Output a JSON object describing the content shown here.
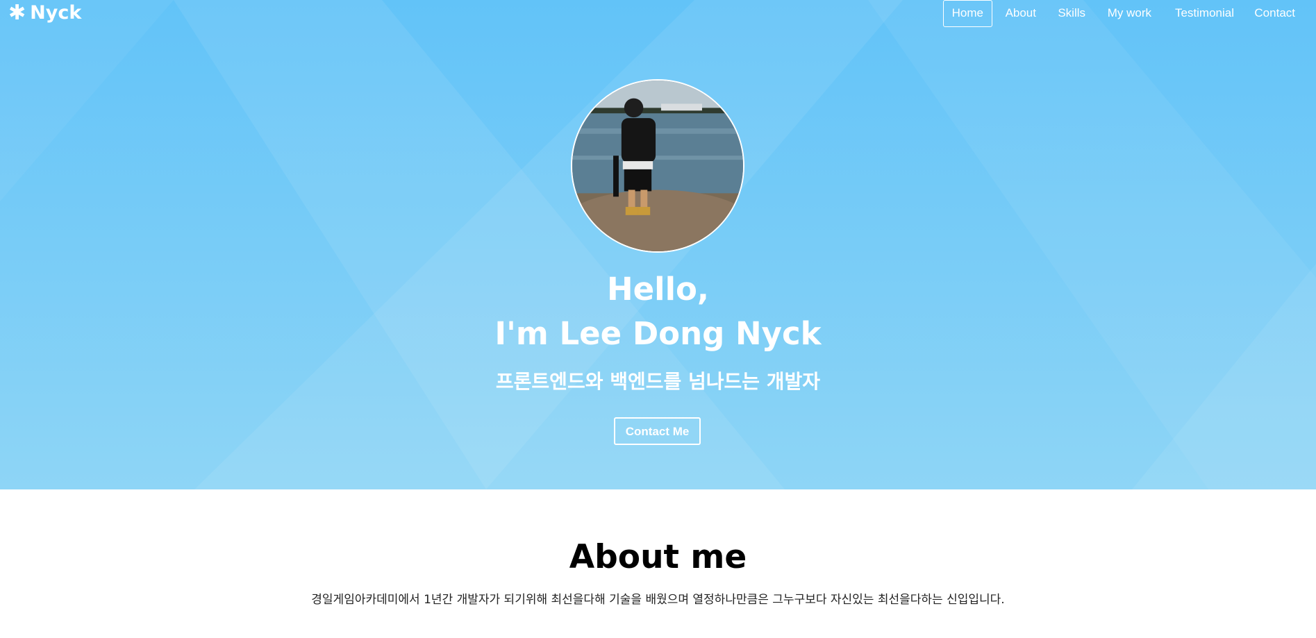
{
  "brand": {
    "icon": "asterisk-icon",
    "name": "Nyck"
  },
  "nav": {
    "items": [
      {
        "label": "Home",
        "active": true
      },
      {
        "label": "About",
        "active": false
      },
      {
        "label": "Skills",
        "active": false
      },
      {
        "label": "My work",
        "active": false
      },
      {
        "label": "Testimonial",
        "active": false
      },
      {
        "label": "Contact",
        "active": false
      }
    ]
  },
  "hero": {
    "greeting_line1": "Hello,",
    "greeting_line2": "I'm Lee Dong Nyck",
    "subtitle": "프론트엔드와 백엔드를 넘나드는 개발자",
    "button_label": "Contact Me",
    "colors": {
      "top": "#62c3f8",
      "bottom": "#8ed5f6"
    }
  },
  "about": {
    "title": "About me",
    "description": "경일게임아카데미에서 1년간 개발자가 되기위해 최선을다해 기술을 배웠으며 열정하나만큼은 그누구보다 자신있는 최선을다하는 신입입니다."
  }
}
